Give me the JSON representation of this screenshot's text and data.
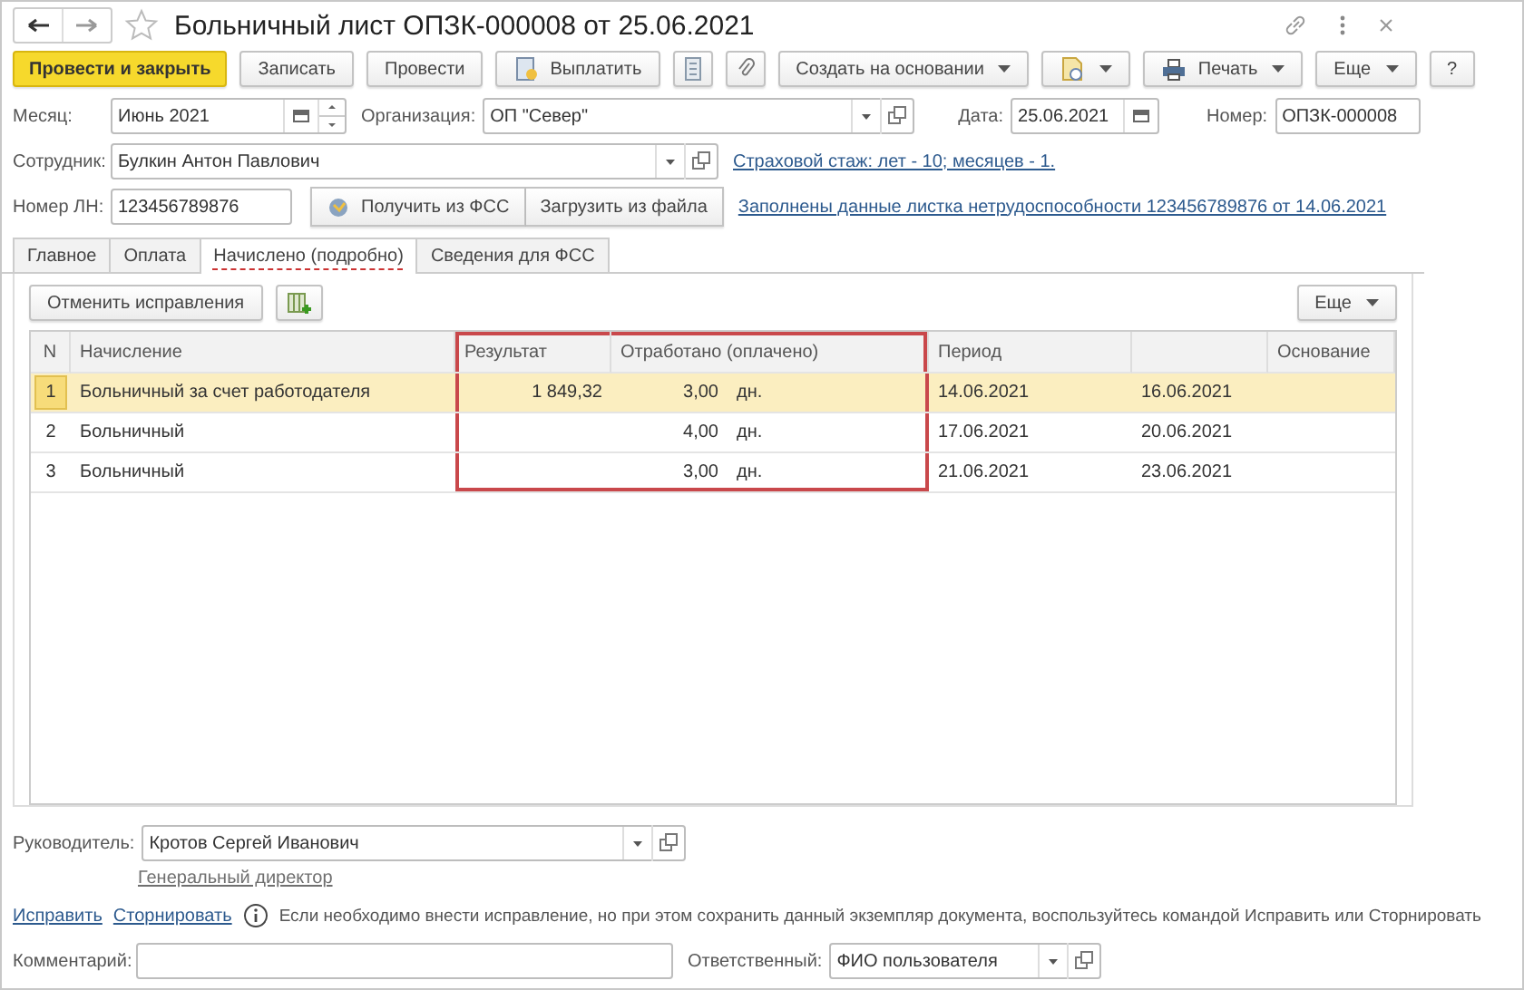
{
  "window": {
    "title": "Больничный лист ОПЗК-000008 от 25.06.2021"
  },
  "toolbar": [
    {
      "label": "Провести и закрыть",
      "kind": "primary"
    },
    {
      "label": "Записать",
      "kind": "plain"
    },
    {
      "label": "Провести",
      "kind": "plain"
    },
    {
      "label": "Выплатить",
      "kind": "pay"
    },
    {
      "kind": "list"
    },
    {
      "kind": "clip"
    },
    {
      "label": "Создать на основании",
      "kind": "menu"
    },
    {
      "kind": "doc-menu"
    },
    {
      "label": "Печать",
      "kind": "print"
    },
    {
      "label": "Еще",
      "kind": "menu"
    },
    {
      "label": "?",
      "kind": "plain"
    }
  ],
  "header": {
    "month": {
      "label": "Месяц:",
      "value": "Июнь 2021"
    },
    "organization": {
      "label": "Организация:",
      "value": "ОП \"Север\""
    },
    "date": {
      "label": "Дата:",
      "value": "25.06.2021"
    },
    "number": {
      "label": "Номер:",
      "value": "ОПЗК-000008"
    }
  },
  "employee": {
    "label": "Сотрудник:",
    "value": "Булкин Антон Павлович",
    "link": "Страховой стаж: лет - 10; месяцев - 1."
  },
  "sick_leave": {
    "label": "Номер ЛН:",
    "value": "123456789876",
    "buttons": [
      {
        "label": "Получить из ФСС",
        "kind": "fss"
      },
      {
        "label": "Загрузить из файла",
        "kind": "plain"
      }
    ],
    "link": "Заполнены данные листка нетрудоспособности 123456789876 от 14.06.2021"
  },
  "tabs": [
    {
      "label": "Главное",
      "selected": false
    },
    {
      "label": "Оплата",
      "selected": false
    },
    {
      "label": "Начислено (подробно)",
      "selected": true
    },
    {
      "label": "Сведения для ФСС",
      "selected": false
    }
  ],
  "table_toolbar": {
    "button": "Отменить исправления",
    "more": "Еще"
  },
  "table": {
    "columns": [
      {
        "label": "N",
        "kind": "index",
        "highlighted": false
      },
      {
        "label": "Начисление",
        "kind": "text",
        "highlighted": false
      },
      {
        "label": "Результат",
        "kind": "amount",
        "highlighted": true
      },
      {
        "label": "Отработано (оплачено)",
        "kind": "quantity",
        "highlighted": true
      },
      {
        "label": "Период",
        "kind": "period",
        "highlighted": false
      },
      {
        "label": "Основание",
        "kind": "basis",
        "highlighted": false
      }
    ],
    "rows": [
      {
        "n": "1",
        "name": "Больничный за счет работодателя",
        "result": "1 849,32",
        "days": "3,00",
        "unit": "дн.",
        "from": "14.06.2021",
        "to": "16.06.2021",
        "selected": true
      },
      {
        "n": "2",
        "name": "Больничный",
        "days": "4,00",
        "unit": "дн.",
        "from": "17.06.2021",
        "to": "20.06.2021",
        "selected": false
      },
      {
        "n": "3",
        "name": "Больничный",
        "days": "3,00",
        "unit": "дн.",
        "from": "21.06.2021",
        "to": "23.06.2021",
        "selected": false
      }
    ]
  },
  "footer": {
    "manager": {
      "label": "Руководитель:",
      "value": "Кротов Сергей Иванович"
    },
    "position_link": "Генеральный директор",
    "actions": [
      "Исправить",
      "Сторнировать"
    ],
    "note": "Если необходимо внести исправление, но при этом сохранить данный экземпляр документа, воспользуйтесь командой Исправить или Сторнировать",
    "comment": {
      "label": "Комментарий:"
    },
    "responsible": {
      "label": "Ответственный:",
      "value": "ФИО пользователя"
    }
  }
}
